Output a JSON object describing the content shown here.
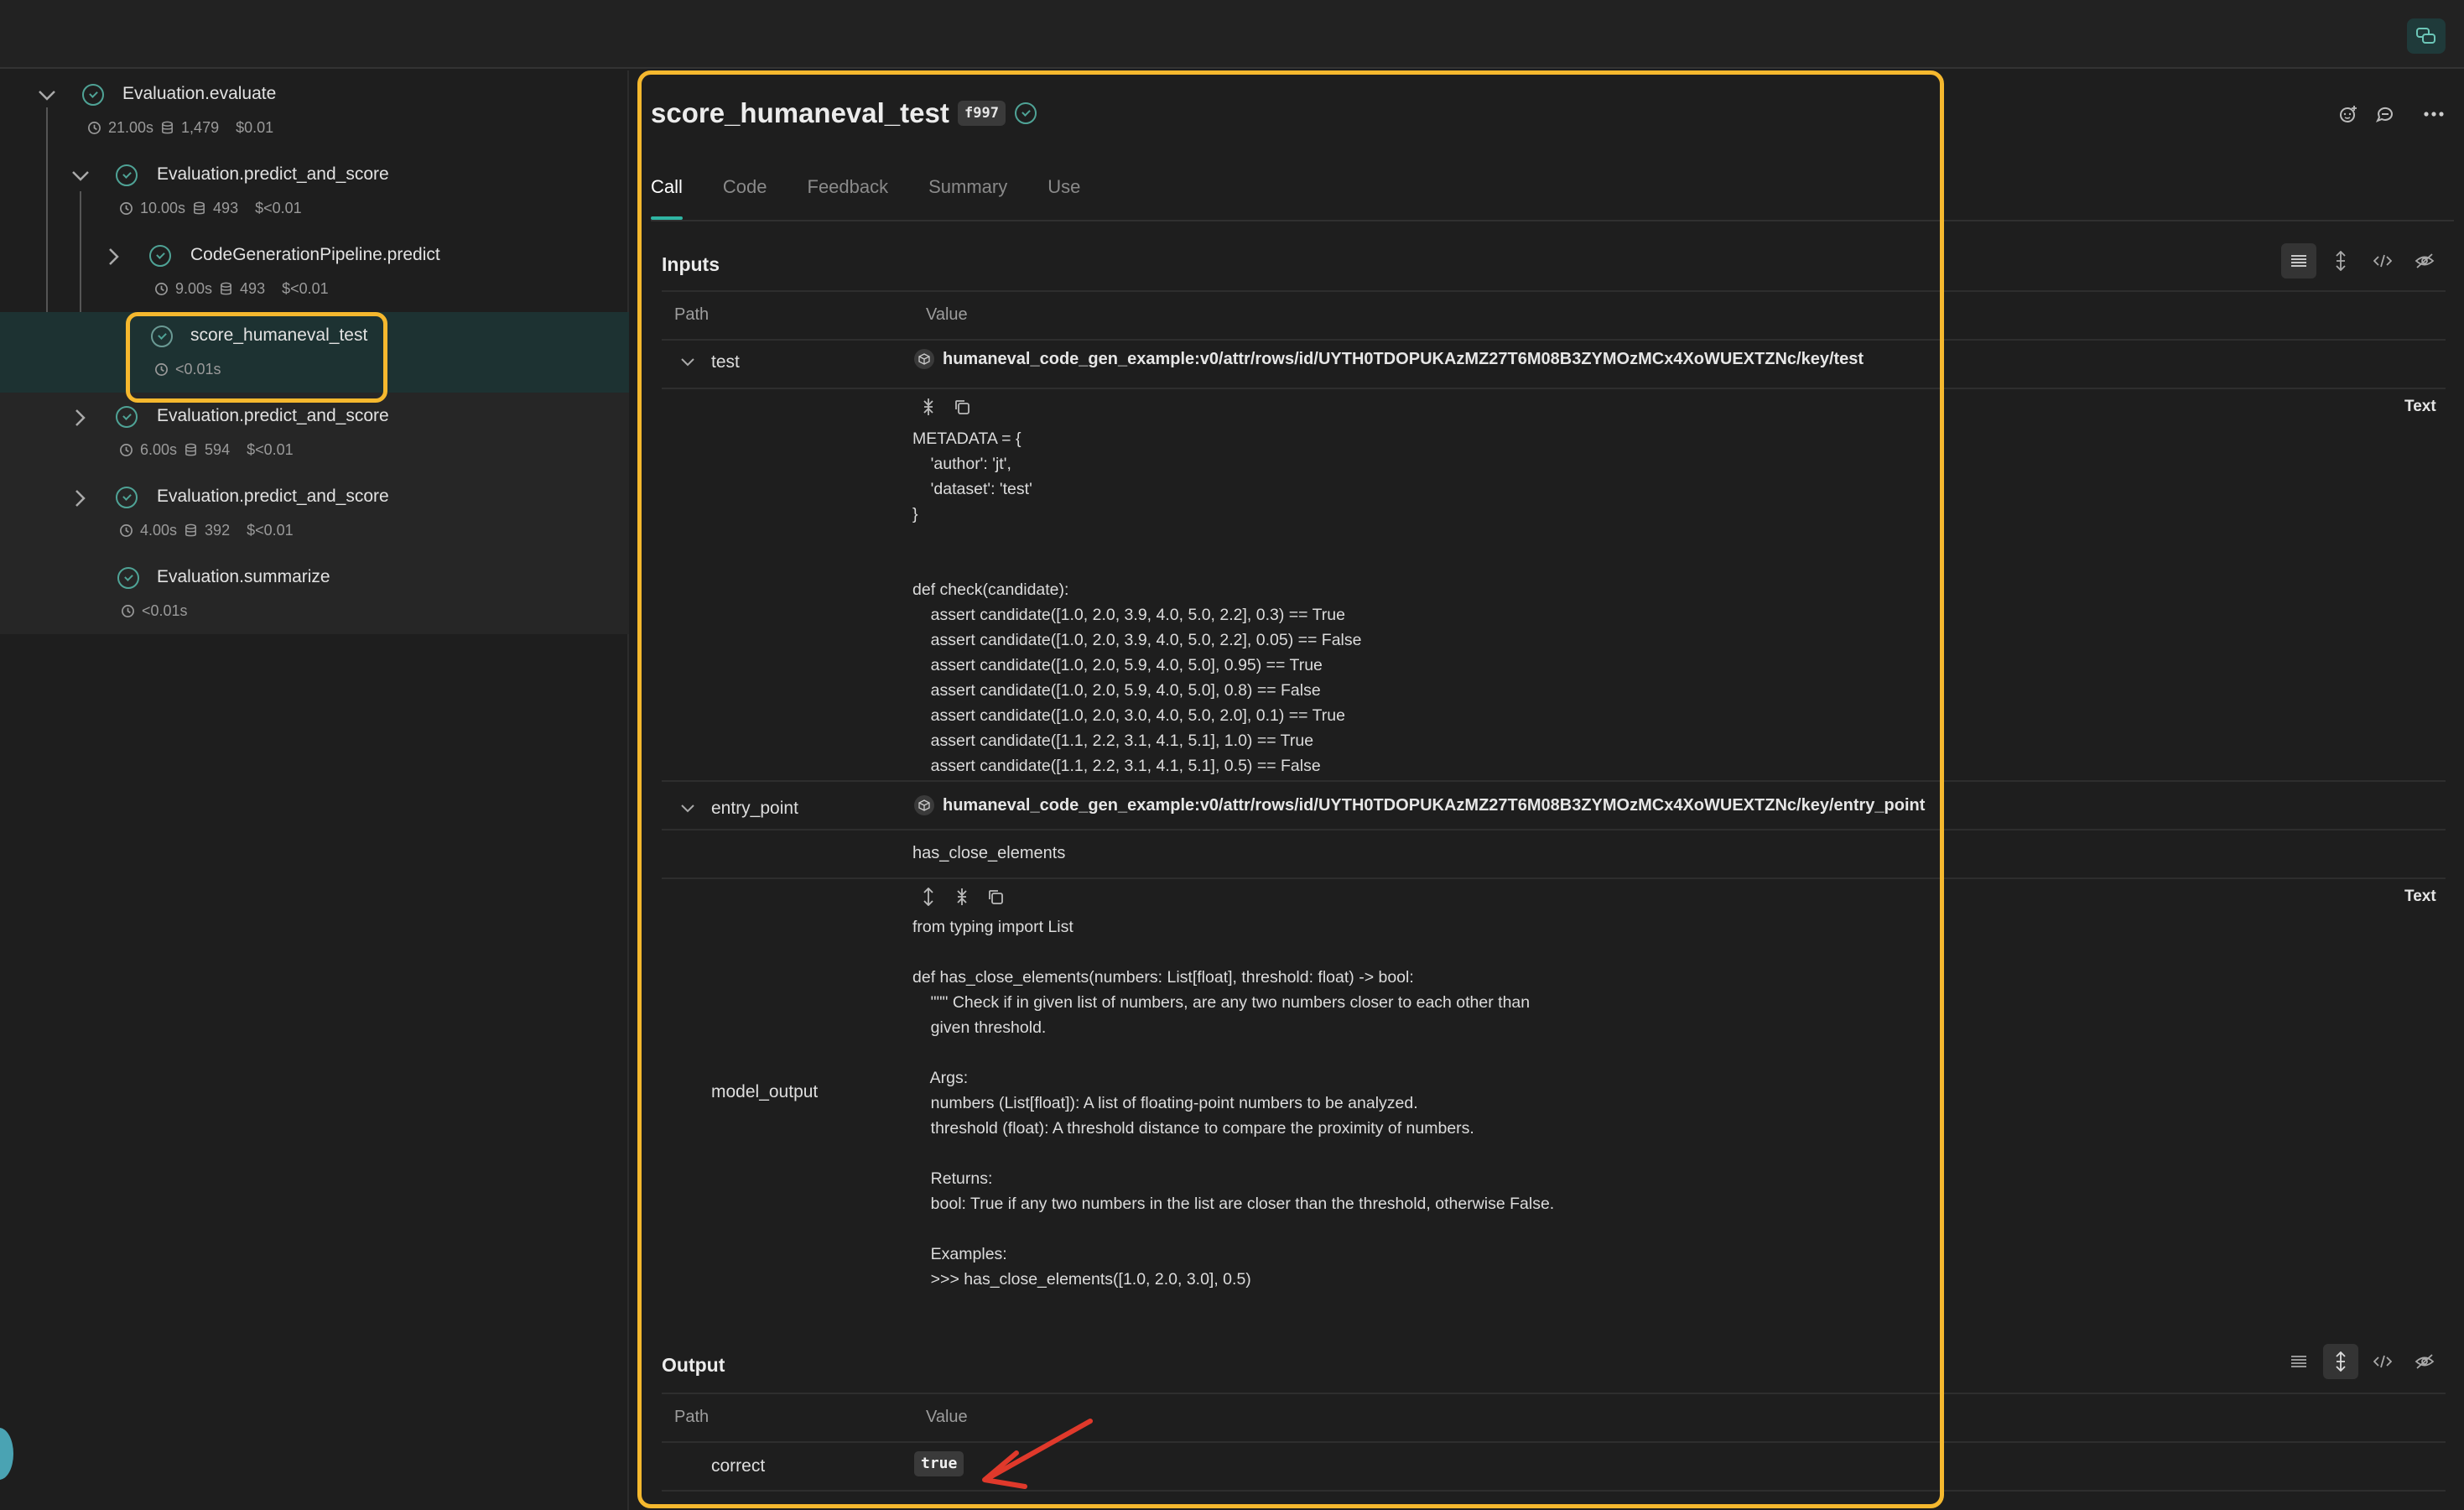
{
  "sidebar": {
    "nodes": [
      {
        "name": "Evaluation.evaluate",
        "time": "21.00s",
        "tokens": "1,479",
        "cost": "$0.01"
      },
      {
        "name": "Evaluation.predict_and_score",
        "time": "10.00s",
        "tokens": "493",
        "cost": "$<0.01"
      },
      {
        "name": "CodeGenerationPipeline.predict",
        "time": "9.00s",
        "tokens": "493",
        "cost": "$<0.01"
      },
      {
        "name": "score_humaneval_test",
        "time": "<0.01s"
      },
      {
        "name": "Evaluation.predict_and_score",
        "time": "6.00s",
        "tokens": "594",
        "cost": "$<0.01"
      },
      {
        "name": "Evaluation.predict_and_score",
        "time": "4.00s",
        "tokens": "392",
        "cost": "$<0.01"
      },
      {
        "name": "Evaluation.summarize",
        "time": "<0.01s"
      }
    ]
  },
  "header": {
    "title": "score_humaneval_test",
    "badge": "f997"
  },
  "tabs": [
    "Call",
    "Code",
    "Feedback",
    "Summary",
    "Use"
  ],
  "inputs": {
    "title": "Inputs",
    "col_path": "Path",
    "col_value": "Value",
    "test": {
      "label": "test",
      "ref": "humaneval_code_gen_example:v0/attr/rows/id/UYTH0TDOPUKAzMZ27T6M08B3ZYMOzMCx4XoWUEXTZNc/key/test",
      "type": "Text",
      "code": "METADATA = {\n    'author': 'jt',\n    'dataset': 'test'\n}\n\n\ndef check(candidate):\n    assert candidate([1.0, 2.0, 3.9, 4.0, 5.0, 2.2], 0.3) == True\n    assert candidate([1.0, 2.0, 3.9, 4.0, 5.0, 2.2], 0.05) == False\n    assert candidate([1.0, 2.0, 5.9, 4.0, 5.0], 0.95) == True\n    assert candidate([1.0, 2.0, 5.9, 4.0, 5.0], 0.8) == False\n    assert candidate([1.0, 2.0, 3.0, 4.0, 5.0, 2.0], 0.1) == True\n    assert candidate([1.1, 2.2, 3.1, 4.1, 5.1], 1.0) == True\n    assert candidate([1.1, 2.2, 3.1, 4.1, 5.1], 0.5) == False"
    },
    "entry_point": {
      "label": "entry_point",
      "ref": "humaneval_code_gen_example:v0/attr/rows/id/UYTH0TDOPUKAzMZ27T6M08B3ZYMOzMCx4XoWUEXTZNc/key/entry_point",
      "value": "has_close_elements"
    },
    "model_output": {
      "label": "model_output",
      "type": "Text",
      "code": "from typing import List\n\ndef has_close_elements(numbers: List[float], threshold: float) -> bool:\n    \"\"\" Check if in given list of numbers, are any two numbers closer to each other than\n    given threshold.\n\n    Args:\n    numbers (List[float]): A list of floating-point numbers to be analyzed.\n    threshold (float): A threshold distance to compare the proximity of numbers.\n\n    Returns:\n    bool: True if any two numbers in the list are closer than the threshold, otherwise False.\n\n    Examples:\n    >>> has_close_elements([1.0, 2.0, 3.0], 0.5)"
    }
  },
  "output": {
    "title": "Output",
    "col_path": "Path",
    "col_value": "Value",
    "correct_label": "correct",
    "correct_value": "true"
  },
  "colors": {
    "accent": "#2fb5a3",
    "highlight": "#f5b82e",
    "arrow": "#e0392b"
  }
}
